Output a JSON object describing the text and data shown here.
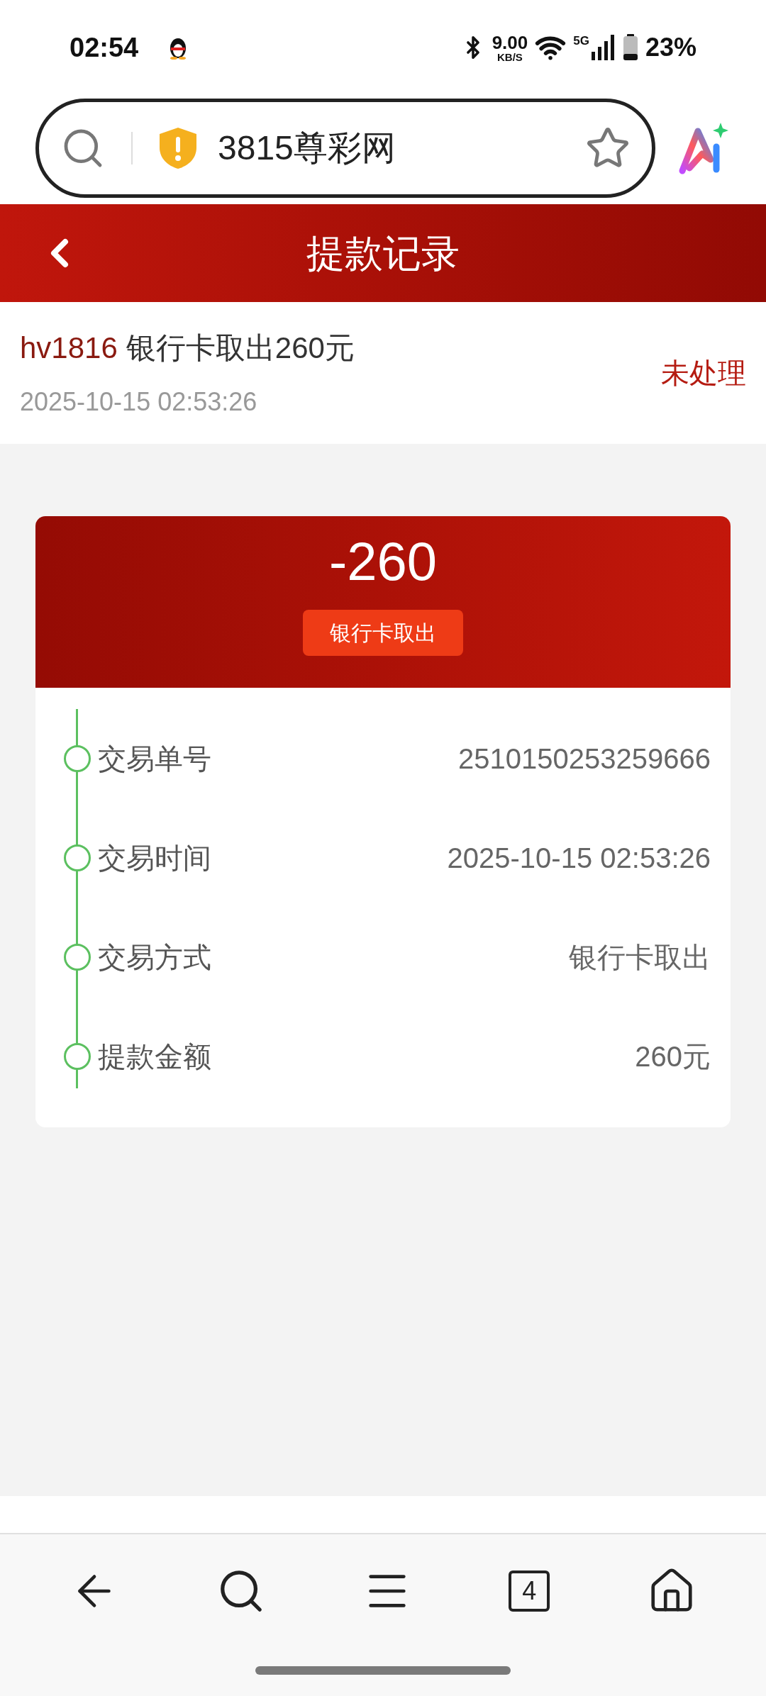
{
  "status_bar": {
    "time": "02:54",
    "net_speed": "9.00",
    "net_unit": "KB/S",
    "network": "5G",
    "battery": "23%"
  },
  "address_bar": {
    "url": "3815尊彩网"
  },
  "header": {
    "title": "提款记录"
  },
  "record": {
    "user": "hv1816",
    "description": "银行卡取出260元",
    "time": "2025-10-15 02:53:26",
    "status": "未处理"
  },
  "detail": {
    "amount": "-260",
    "method_badge": "银行卡取出",
    "rows": [
      {
        "label": "交易单号",
        "value": "2510150253259666"
      },
      {
        "label": "交易时间",
        "value": "2025-10-15 02:53:26"
      },
      {
        "label": "交易方式",
        "value": "银行卡取出"
      },
      {
        "label": "提款金额",
        "value": "260元"
      }
    ]
  },
  "bottom_nav": {
    "tab_count": "4"
  }
}
